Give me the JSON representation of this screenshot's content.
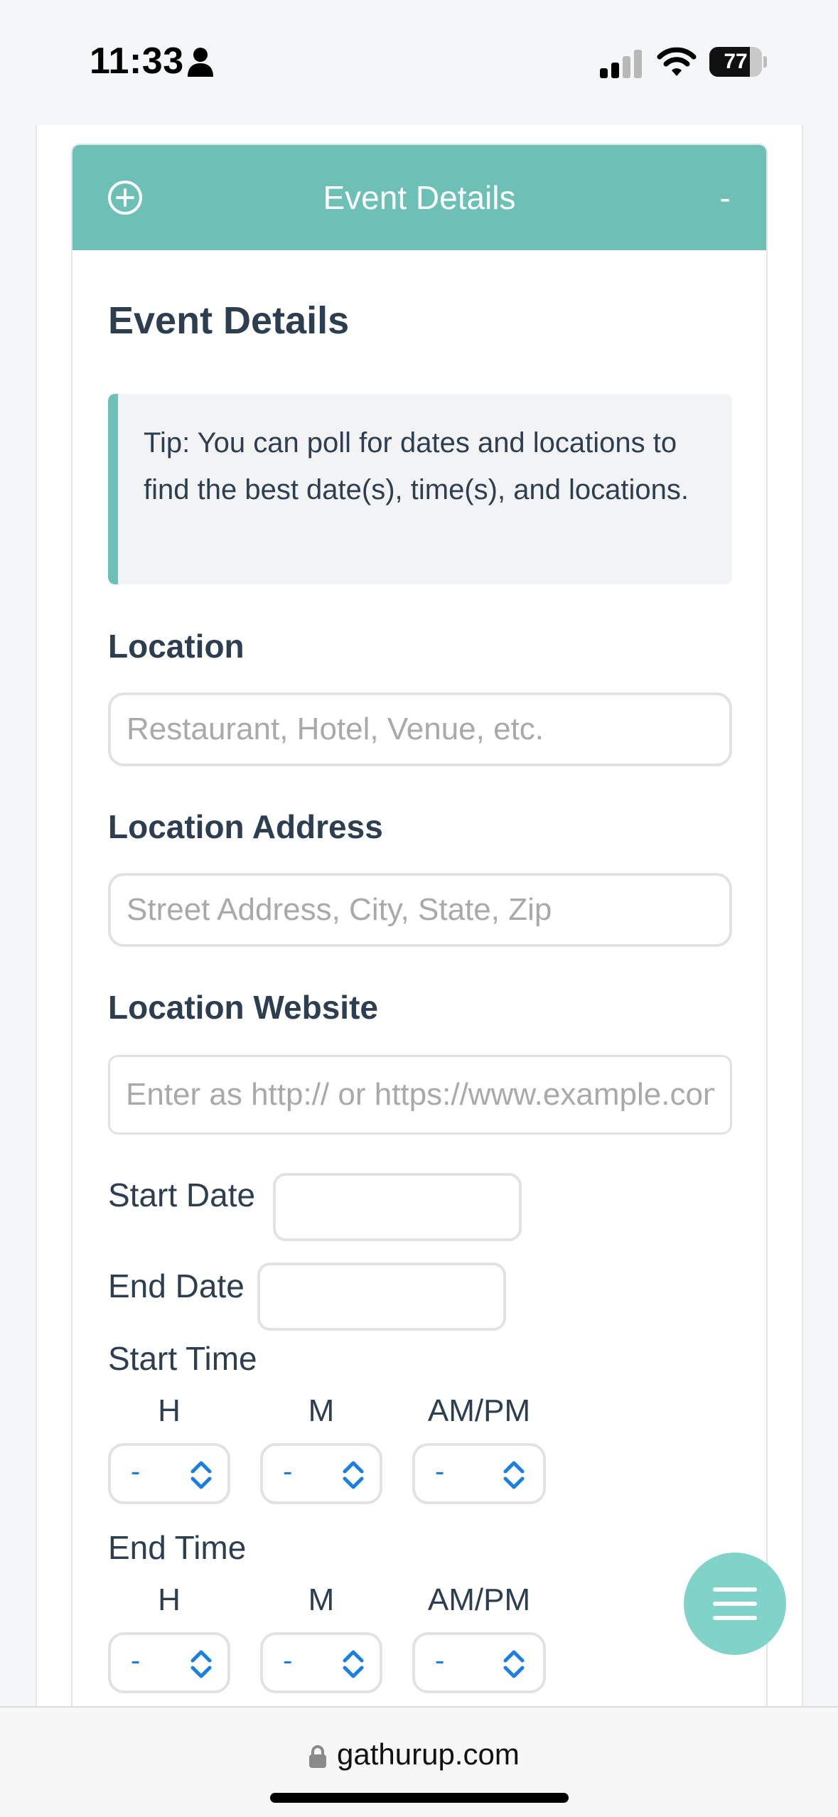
{
  "status_bar": {
    "time": "11:33",
    "battery_percent": "77",
    "battery_level": 0.77
  },
  "panel": {
    "header_title": "Event Details",
    "collapse_label": "-",
    "section_title": "Event Details",
    "tip": "Tip: You can poll for dates and locations to find the best date(s), time(s), and locations."
  },
  "form": {
    "location": {
      "label": "Location",
      "placeholder": "Restaurant, Hotel, Venue, etc.",
      "value": ""
    },
    "location_address": {
      "label": "Location Address",
      "placeholder": "Street Address, City, State, Zip",
      "value": ""
    },
    "location_website": {
      "label": "Location Website",
      "placeholder": "Enter as http:// or https://www.example.com",
      "value": ""
    },
    "start_date": {
      "label": "Start Date",
      "value": ""
    },
    "end_date": {
      "label": "End Date",
      "value": ""
    },
    "start_time": {
      "label": "Start Time",
      "hour_label": "H",
      "minute_label": "M",
      "ampm_label": "AM/PM",
      "hour": "-",
      "minute": "-",
      "ampm": "-"
    },
    "end_time": {
      "label": "End Time",
      "hour_label": "H",
      "minute_label": "M",
      "ampm_label": "AM/PM",
      "hour": "-",
      "minute": "-",
      "ampm": "-"
    }
  },
  "browser": {
    "url": "gathurup.com"
  },
  "colors": {
    "accent": "#6dc0b6",
    "fab": "#7fd3c9",
    "text": "#2c3e50",
    "select_value": "#1a7fe0"
  },
  "icons": [
    "person-icon",
    "signal-icon",
    "wifi-icon",
    "plus-circle-icon",
    "chevrons-icon",
    "hamburger-icon",
    "lock-icon"
  ]
}
